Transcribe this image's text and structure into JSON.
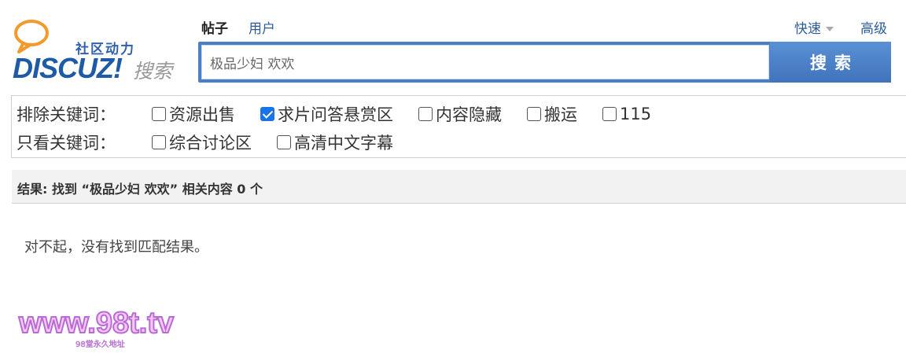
{
  "logo": {
    "tagline": "社区动力",
    "brand": "DISCUZ!",
    "brand_sub": "搜索"
  },
  "tabs": [
    {
      "label": "帖子",
      "active": true
    },
    {
      "label": "用户",
      "active": false
    }
  ],
  "right_links": {
    "quick": "快速",
    "advanced": "高级"
  },
  "search": {
    "value": "极品少妇 欢欢",
    "button": "搜索"
  },
  "filters": {
    "exclude_label": "排除关键词：",
    "exclude_options": [
      {
        "label": "资源出售",
        "checked": false
      },
      {
        "label": "求片问答悬赏区",
        "checked": true
      },
      {
        "label": "内容隐藏",
        "checked": false
      },
      {
        "label": "搬运",
        "checked": false
      },
      {
        "label": "115",
        "checked": false
      }
    ],
    "only_label": "只看关键词：",
    "only_options": [
      {
        "label": "综合讨论区",
        "checked": false
      },
      {
        "label": "高清中文字幕",
        "checked": false
      }
    ]
  },
  "results": {
    "summary": "结果: 找到 “极品少妇 欢欢” 相关内容 0 个",
    "empty_message": "对不起，没有找到匹配结果。"
  },
  "watermark": {
    "main": "www.98t.tv",
    "sub": "98堂永久地址"
  },
  "colors": {
    "brand_blue": "#4b7fc4",
    "link_blue": "#2c5c98",
    "checkbox_checked": "#1a73e8"
  }
}
